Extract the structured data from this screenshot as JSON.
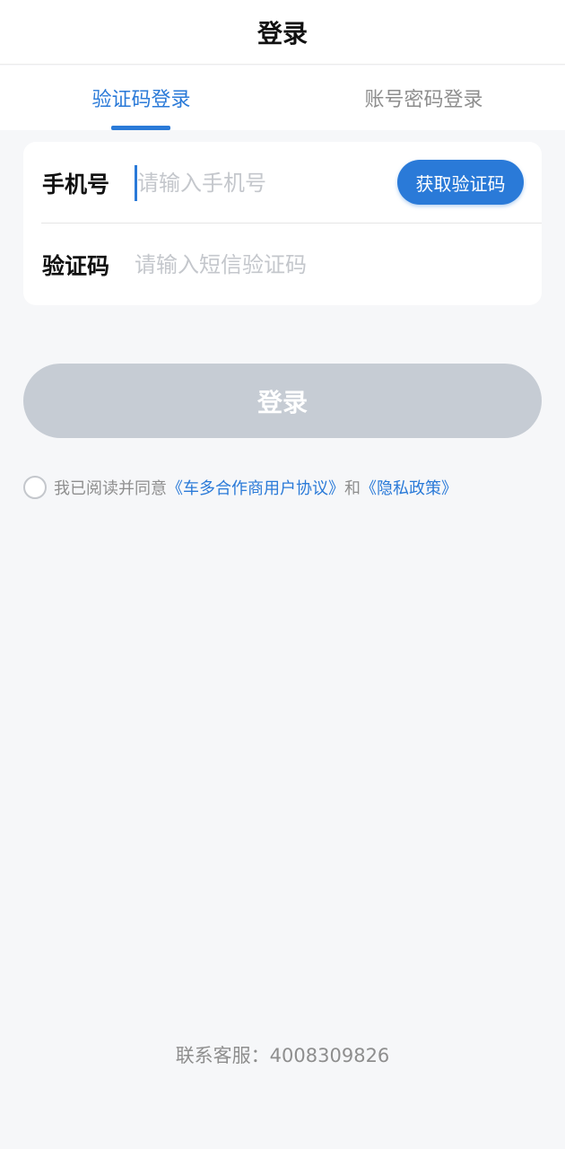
{
  "header": {
    "title": "登录"
  },
  "tabs": [
    {
      "label": "验证码登录",
      "active": true
    },
    {
      "label": "账号密码登录",
      "active": false
    }
  ],
  "form": {
    "phone_label": "手机号",
    "phone_placeholder": "请输入手机号",
    "get_code_label": "获取验证码",
    "code_label": "验证码",
    "code_placeholder": "请输入短信验证码"
  },
  "login_button": "登录",
  "agreement": {
    "prefix": "我已阅读并同意",
    "user_agreement": "《车多合作商用户协议》",
    "and": "和",
    "privacy_policy": "《隐私政策》"
  },
  "footer": {
    "service": "联系客服：4008309826"
  },
  "colors": {
    "accent": "#2a7ad8",
    "disabled_button": "#c6ccd4",
    "background": "#f6f7f9"
  }
}
